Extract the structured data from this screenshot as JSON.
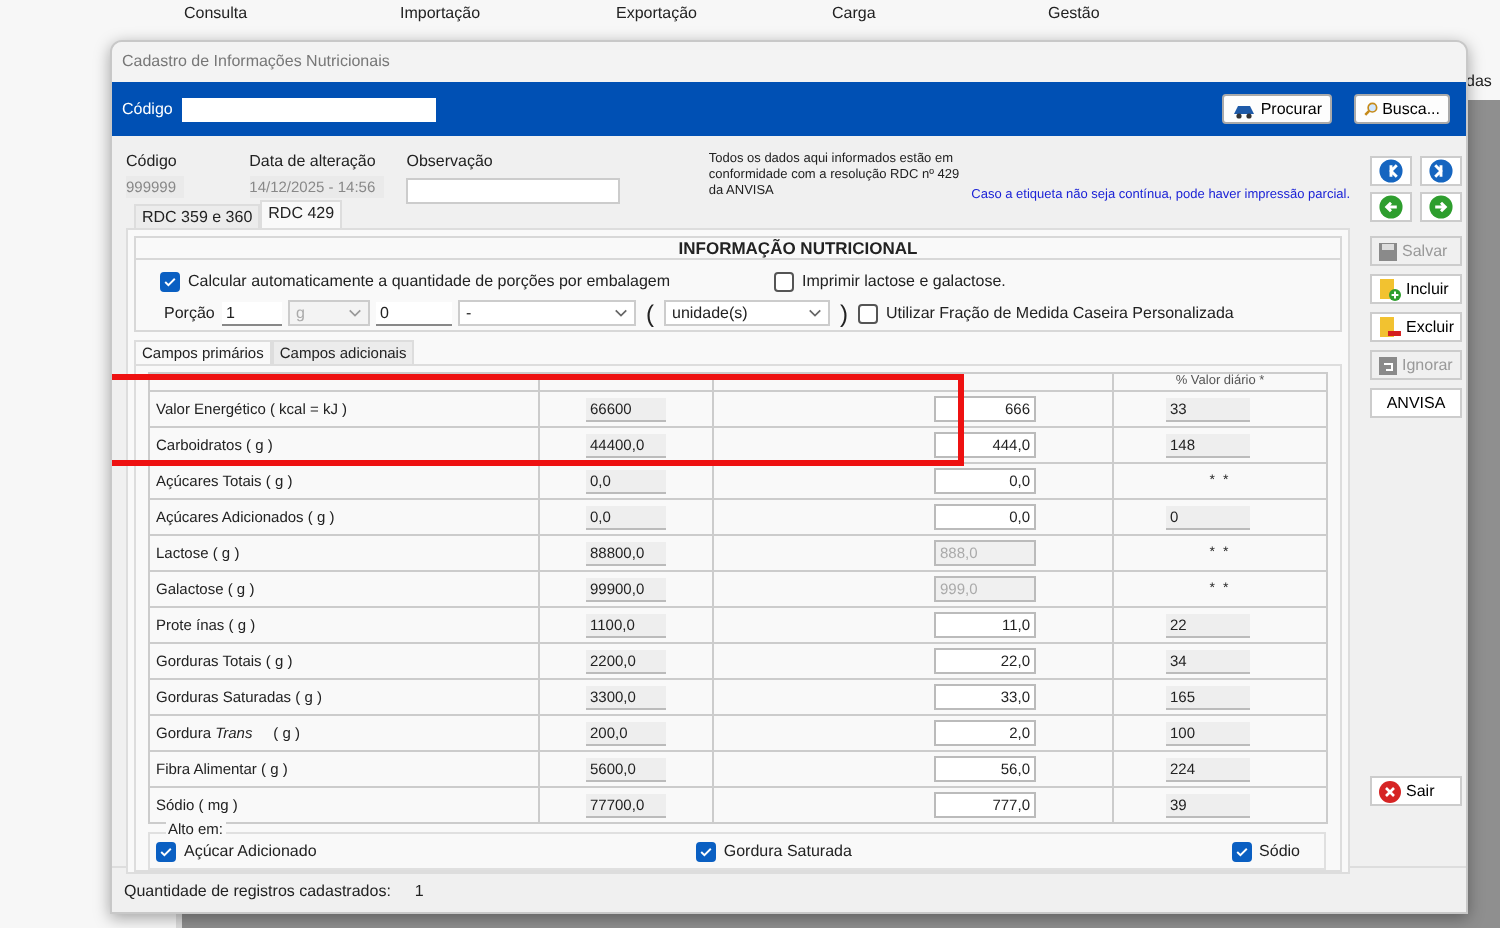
{
  "background_app": {
    "menu": [
      "Consulta",
      "Importação",
      "Exportação",
      "Carga",
      "Gestão"
    ],
    "edge_text": "das"
  },
  "window": {
    "title": "Cadastro de Informações Nutricionais"
  },
  "search_bar": {
    "label": "Código",
    "find_button": "Procurar",
    "browse_button": "Busca..."
  },
  "record": {
    "code_label": "Código",
    "code": "999999",
    "date_label": "Data de alteração",
    "date": "14/12/2025 - 14:56",
    "note_label": "Observação",
    "notice": "Todos os dados aqui informados estão em conformidade com a resolução RDC nº 429 da ANVISA",
    "print_hint": "Caso a etiqueta não seja contínua, pode haver impressão parcial."
  },
  "tabs": [
    {
      "label": "RDC 359 e 360",
      "selected": false
    },
    {
      "label": "RDC 429",
      "selected": true
    }
  ],
  "nutrition": {
    "title": "INFORMAÇÃO NUTRICIONAL",
    "auto_calc": {
      "label": "Calcular automaticamente a quantidade de porções por embalagem",
      "checked": true
    },
    "print_lactose": {
      "label": "Imprimir lactose e galactose.",
      "checked": false
    },
    "portion": {
      "label": "Porção",
      "amount": "1",
      "unit": "g",
      "household_amount": "0",
      "fraction": "-",
      "open_paren": "(",
      "household_unit": "unidade(s)",
      "close_paren": ")"
    },
    "custom_fraction": {
      "label": "Utilizar Fração de Medida Caseira Personalizada",
      "checked": false
    }
  },
  "subtabs": [
    {
      "label": "Campos primários",
      "selected": true
    },
    {
      "label": "Campos adicionais",
      "selected": false
    }
  ],
  "table": {
    "columns": {
      "daily_value": "% Valor diário *"
    },
    "rows": [
      {
        "label": "Valor Energético ( kcal = kJ )",
        "per_100g": "66600",
        "portion": "666",
        "portion_disabled": false,
        "daily_value": "33",
        "dv_boxed": true
      },
      {
        "label": "Carboidratos ( g )",
        "per_100g": "44400,0",
        "portion": "444,0",
        "portion_disabled": false,
        "daily_value": "148",
        "dv_boxed": true
      },
      {
        "label": "Açúcares Totais ( g )",
        "per_100g": "0,0",
        "portion": "0,0",
        "portion_disabled": false,
        "daily_value": "* *",
        "dv_boxed": false
      },
      {
        "label": "Açúcares Adicionados ( g )",
        "per_100g": "0,0",
        "portion": "0,0",
        "portion_disabled": false,
        "daily_value": "0",
        "dv_boxed": true
      },
      {
        "label": "Lactose ( g )",
        "per_100g": "88800,0",
        "portion": "888,0",
        "portion_disabled": true,
        "daily_value": "* *",
        "dv_boxed": false
      },
      {
        "label": "Galactose ( g )",
        "per_100g": "99900,0",
        "portion": "999,0",
        "portion_disabled": true,
        "daily_value": "* *",
        "dv_boxed": false
      },
      {
        "label": "Prote ínas ( g )",
        "per_100g": "1100,0",
        "portion": "11,0",
        "portion_disabled": false,
        "daily_value": "22",
        "dv_boxed": true
      },
      {
        "label": "Gorduras Totais ( g )",
        "per_100g": "2200,0",
        "portion": "22,0",
        "portion_disabled": false,
        "daily_value": "34",
        "dv_boxed": true
      },
      {
        "label": "Gorduras Saturadas ( g )",
        "per_100g": "3300,0",
        "portion": "33,0",
        "portion_disabled": false,
        "daily_value": "165",
        "dv_boxed": true
      },
      {
        "label": "Gordura *Trans*     ( g )",
        "per_100g": "200,0",
        "portion": "2,0",
        "portion_disabled": false,
        "daily_value": "100",
        "dv_boxed": true
      },
      {
        "label": "Fibra Alimentar ( g )",
        "per_100g": "5600,0",
        "portion": "56,0",
        "portion_disabled": false,
        "daily_value": "224",
        "dv_boxed": true
      },
      {
        "label": "Sódio ( mg )",
        "per_100g": "77700,0",
        "portion": "777,0",
        "portion_disabled": false,
        "daily_value": "39",
        "dv_boxed": true
      }
    ]
  },
  "high_in": {
    "label": "Alto em:",
    "items": [
      {
        "label": "Açúcar Adicionado",
        "checked": true
      },
      {
        "label": "Gordura Saturada",
        "checked": true
      },
      {
        "label": "Sódio",
        "checked": true
      }
    ]
  },
  "actions": [
    {
      "label": "Salvar",
      "kind": "save",
      "disabled": true
    },
    {
      "label": "Incluir",
      "kind": "add",
      "disabled": false
    },
    {
      "label": "Excluir",
      "kind": "delete",
      "disabled": false
    },
    {
      "label": "Ignorar",
      "kind": "undo",
      "disabled": true
    },
    {
      "label": "ANVISA",
      "kind": "plain",
      "disabled": false
    }
  ],
  "exit_button": "Sair",
  "status_bar": {
    "label": "Quantidade de registros cadastrados:",
    "count": "1"
  }
}
